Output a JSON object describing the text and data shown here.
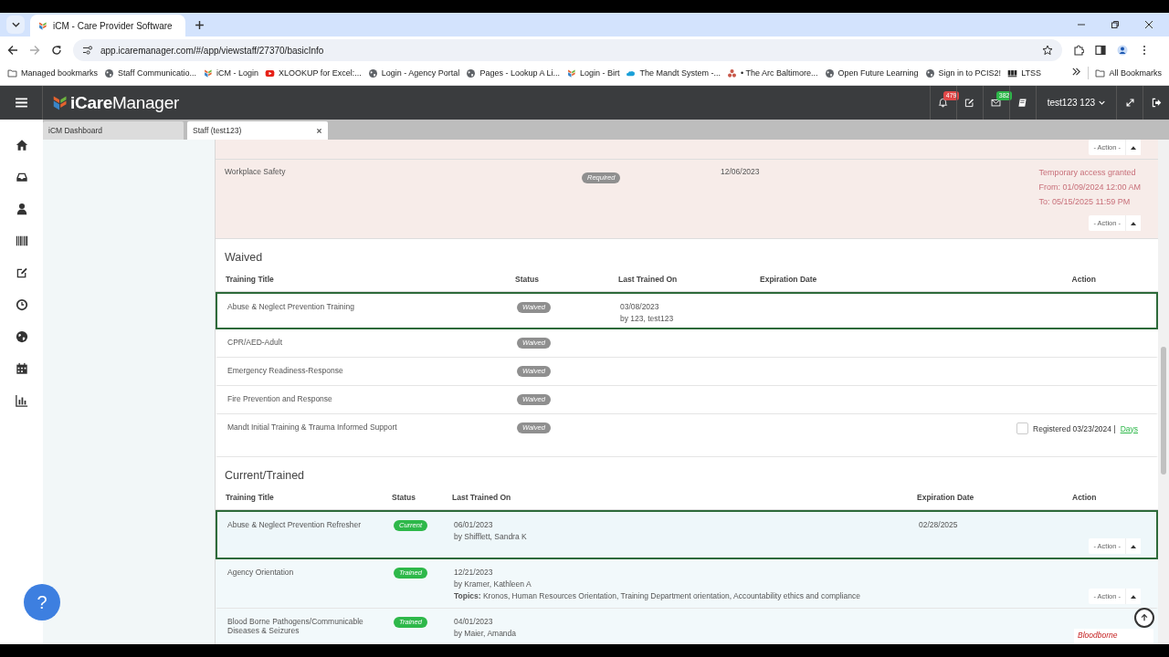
{
  "browser": {
    "tabs": [
      {
        "title": "iCM - Care Provider Software",
        "selected": true
      }
    ],
    "url": "app.icaremanager.com/#/app/viewstaff/27370/basicInfo",
    "bookmarks": [
      {
        "kind": "folder",
        "title": "Managed bookmarks"
      },
      {
        "kind": "globe",
        "title": "Staff Communicatio..."
      },
      {
        "kind": "icm",
        "title": "iCM - Login"
      },
      {
        "kind": "video",
        "title": "XLOOKUP for Excel:..."
      },
      {
        "kind": "globe",
        "title": "Login - Agency Portal"
      },
      {
        "kind": "globe",
        "title": "Pages - Lookup A Li..."
      },
      {
        "kind": "icm",
        "title": "Login - Birt"
      },
      {
        "kind": "cloud",
        "title": "The Mandt System -..."
      },
      {
        "kind": "dots",
        "title": "• The Arc Baltimore..."
      },
      {
        "kind": "globe",
        "title": "Open Future Learning"
      },
      {
        "kind": "globe",
        "title": "Sign in to PCIS2!"
      },
      {
        "kind": "emblem",
        "title": "LTSS"
      }
    ],
    "all_bookmarks": "All Bookmarks"
  },
  "app": {
    "brand": "**iCare**Manager",
    "actions": [
      {
        "kind": "bell",
        "badge": {
          "text": "479",
          "color": "#e04848"
        }
      },
      {
        "kind": "edit"
      },
      {
        "kind": "mail",
        "badge": {
          "text": "382",
          "color": "#2eb84a"
        }
      },
      {
        "kind": "book"
      }
    ],
    "user": "test123 123",
    "sidebar": [
      {
        "kind": "home"
      },
      {
        "kind": "inbox"
      },
      {
        "kind": "person"
      },
      {
        "kind": "barcode"
      },
      {
        "kind": "edit"
      },
      {
        "kind": "clock"
      },
      {
        "kind": "globe"
      },
      {
        "kind": "calendar"
      },
      {
        "kind": "chart"
      }
    ],
    "tabs": [
      {
        "label": "iCM Dashboard",
        "selected": false,
        "closable": false
      },
      {
        "label": "Staff (test123)",
        "selected": true,
        "closable": true
      }
    ]
  },
  "required": {
    "action": "- Action -",
    "rows": [
      {
        "title": "Workplace Safety",
        "status": {
          "text": "Required",
          "color": "#8f8f8f"
        },
        "last_trained": "12/06/2023",
        "notes": [
          "Temporary access granted",
          "From: 01/09/2024 12:00 AM",
          "To: 05/15/2025 11:59 PM"
        ],
        "action": "- Action -"
      }
    ]
  },
  "waived": {
    "title": "Waived",
    "columns": [
      "Training Title",
      "Status",
      "Last Trained On",
      "Expiration Date",
      "Action"
    ],
    "rows": [
      {
        "title": "Abuse & Neglect Prevention Training",
        "status": {
          "text": "Waived",
          "color": "#8f8f8f"
        },
        "selected": true,
        "last_trained": [
          "03/08/2023",
          "by 123, test123"
        ]
      },
      {
        "title": "CPR/AED-Adult",
        "status": {
          "text": "Waived",
          "color": "#8f8f8f"
        },
        "selected": false
      },
      {
        "title": "Emergency  Readiness-Response",
        "status": {
          "text": "Waived",
          "color": "#8f8f8f"
        },
        "selected": false
      },
      {
        "title": "Fire Prevention and Response",
        "status": {
          "text": "Waived",
          "color": "#8f8f8f"
        },
        "selected": false
      },
      {
        "title": "Mandt Initial Training & Trauma Informed Support",
        "status": {
          "text": "Waived",
          "color": "#8f8f8f"
        },
        "selected": false,
        "registered": {
          "checked": false,
          "text": "Registered 03/23/2024 |",
          "link": "Days"
        }
      }
    ]
  },
  "current": {
    "title": "Current/Trained",
    "columns": [
      "Training Title",
      "Status",
      "Last Trained On",
      "Expiration Date",
      "Action"
    ],
    "rows": [
      {
        "title": "Abuse & Neglect Prevention Refresher",
        "status": {
          "text": "Current",
          "color": "#2eb84a"
        },
        "selected": true,
        "date": "06/01/2023",
        "by": "by Shifflett, Sandra K",
        "expiration": "02/28/2025",
        "action": "- Action -"
      },
      {
        "title": "Agency  Orientation",
        "status": {
          "text": "Trained",
          "color": "#2eb84a"
        },
        "selected": false,
        "date": "12/21/2023",
        "by": "by Kramer, Kathleen A",
        "topics_label": "Topics:",
        "topics": "Kronos, Human Resources Orientation, Training Department orientation, Accountability ethics and compliance",
        "action": "- Action -"
      },
      {
        "title": "Blood Borne Pathogens/Communicable Diseases & Seizures",
        "status": {
          "text": "Trained",
          "color": "#2eb84a"
        },
        "selected": false,
        "date": "04/01/2023",
        "by": "by Maier, Amanda",
        "note": "Bloodborne"
      }
    ]
  },
  "help": "?"
}
